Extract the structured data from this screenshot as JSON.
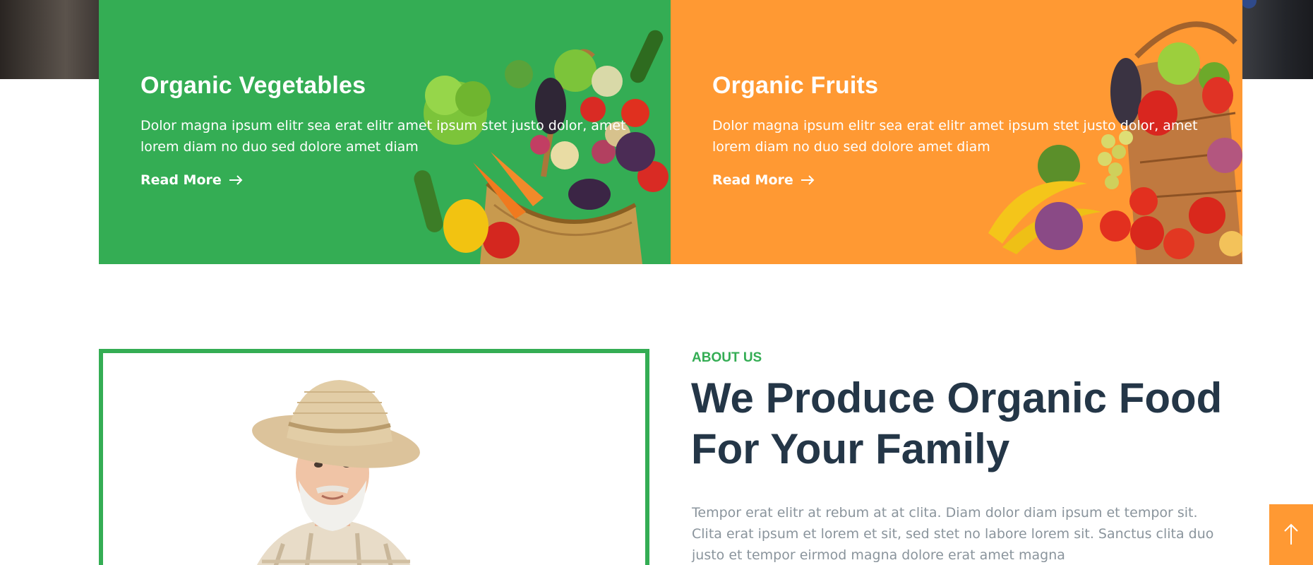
{
  "cards": [
    {
      "title": "Organic Vegetables",
      "text": "Dolor magna ipsum elitr sea erat elitr amet ipsum stet justo dolor, amet lorem diam no duo sed dolore amet diam",
      "link_label": "Read More",
      "color": "#34ad54"
    },
    {
      "title": "Organic Fruits",
      "text": "Dolor magna ipsum elitr sea erat elitr amet ipsum stet justo dolor, amet lorem diam no duo sed dolore amet diam",
      "link_label": "Read More",
      "color": "#ff9933"
    }
  ],
  "about": {
    "eyebrow": "ABOUT US",
    "heading": "We Produce Organic Food For Your Family",
    "text": "Tempor erat elitr at rebum at at clita. Diam dolor diam ipsum et tempor sit. Clita erat ipsum et lorem et sit, sed stet no labore lorem sit. Sanctus clita duo justo et tempor eirmod magna dolore erat amet magna"
  },
  "icons": {
    "card_link_arrow": "arrow-right-icon",
    "back_to_top": "arrow-up-icon"
  },
  "colors": {
    "accent_green": "#34ad54",
    "accent_orange": "#ff9933",
    "heading_navy": "#243647",
    "body_gray": "#8a949c"
  }
}
